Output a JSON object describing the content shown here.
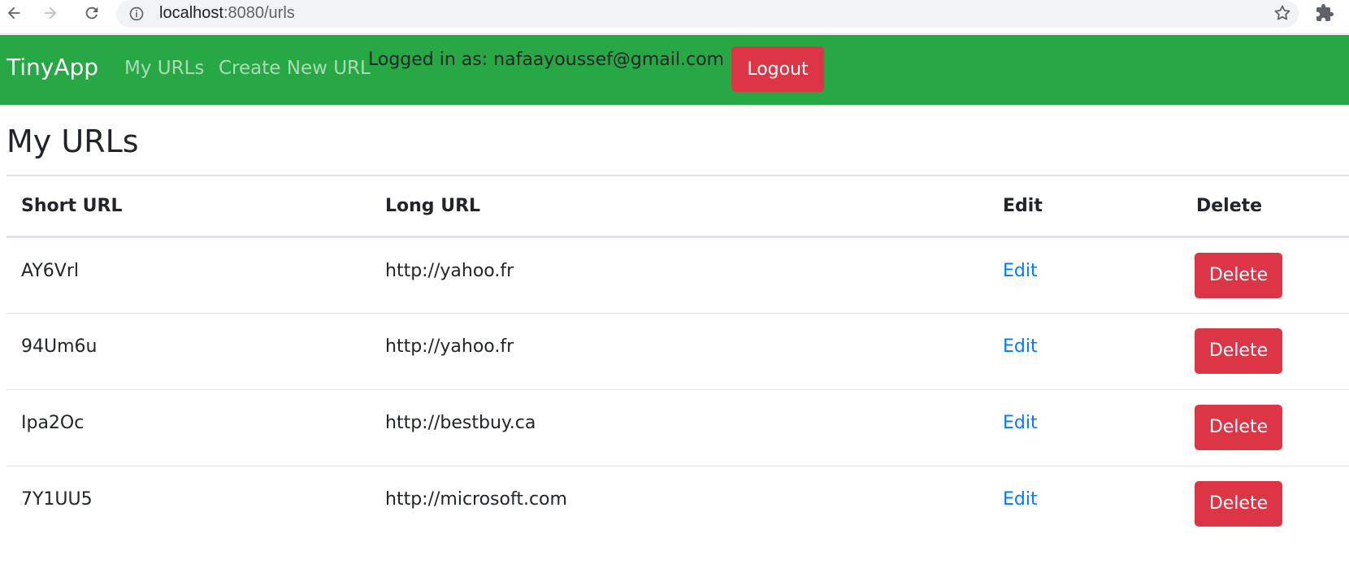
{
  "browser": {
    "url_host": "localhost",
    "url_path": ":8080/urls"
  },
  "navbar": {
    "brand": "TinyApp",
    "links": [
      {
        "label": "My URLs"
      },
      {
        "label": "Create New URL"
      }
    ],
    "logged_in_text": "Logged in as: nafaayoussef@gmail.com",
    "logout_label": "Logout",
    "bg_color": "#28a745",
    "danger_color": "#dc3545"
  },
  "main": {
    "title": "My URLs",
    "table": {
      "headers": [
        "Short URL",
        "Long URL",
        "Edit",
        "Delete"
      ],
      "rows": [
        {
          "short": "AY6Vrl",
          "long": "http://yahoo.fr",
          "edit": "Edit",
          "delete": "Delete"
        },
        {
          "short": "94Um6u",
          "long": "http://yahoo.fr",
          "edit": "Edit",
          "delete": "Delete"
        },
        {
          "short": "Ipa2Oc",
          "long": "http://bestbuy.ca",
          "edit": "Edit",
          "delete": "Delete"
        },
        {
          "short": "7Y1UU5",
          "long": "http://microsoft.com",
          "edit": "Edit",
          "delete": "Delete"
        }
      ]
    }
  }
}
